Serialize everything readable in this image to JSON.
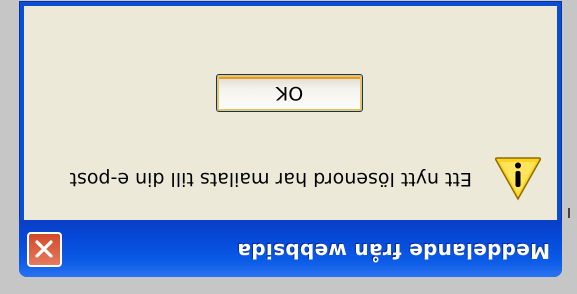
{
  "dialog": {
    "title": "Meddelande från webbsida",
    "message": "Ett nytt lösenord har mailats till din e-post",
    "ok_label": "OK"
  },
  "icons": {
    "close": "close-icon",
    "warning": "warning-icon"
  },
  "colors": {
    "titlebar": "#0a5ae6",
    "client": "#ece9d8",
    "close_button": "#d24a2a",
    "warning_yellow": "#ffd21f"
  }
}
